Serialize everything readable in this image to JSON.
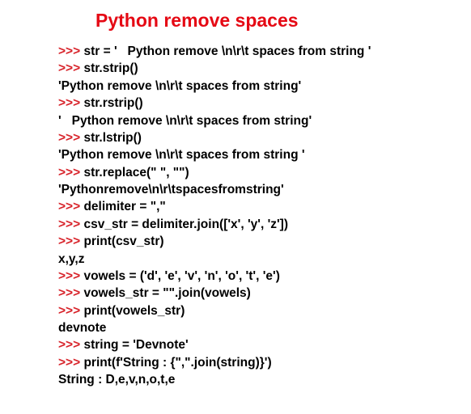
{
  "title": "Python remove spaces",
  "lines": [
    {
      "type": "input",
      "text": "str = '   Python remove \\n\\r\\t spaces from string '"
    },
    {
      "type": "input",
      "text": "str.strip()"
    },
    {
      "type": "output",
      "text": "'Python remove \\n\\r\\t spaces from string'"
    },
    {
      "type": "input",
      "text": "str.rstrip()"
    },
    {
      "type": "output",
      "text": "'   Python remove \\n\\r\\t spaces from string'"
    },
    {
      "type": "input",
      "text": "str.lstrip()"
    },
    {
      "type": "output",
      "text": "'Python remove \\n\\r\\t spaces from string '"
    },
    {
      "type": "input",
      "text": "str.replace(\" \", \"\")"
    },
    {
      "type": "output",
      "text": "'Pythonremove\\n\\r\\tspacesfromstring'"
    },
    {
      "type": "input",
      "text": "delimiter = \",\""
    },
    {
      "type": "input",
      "text": "csv_str = delimiter.join(['x', 'y', 'z'])"
    },
    {
      "type": "input",
      "text": "print(csv_str)"
    },
    {
      "type": "output",
      "text": "x,y,z"
    },
    {
      "type": "input",
      "text": "vowels = ('d', 'e', 'v', 'n', 'o', 't', 'e')"
    },
    {
      "type": "input",
      "text": "vowels_str = \"\".join(vowels)"
    },
    {
      "type": "input",
      "text": "print(vowels_str)"
    },
    {
      "type": "output",
      "text": "devnote"
    },
    {
      "type": "input",
      "text": "string = 'Devnote'"
    },
    {
      "type": "input",
      "text": "print(f'String : {\",\".join(string)}')"
    },
    {
      "type": "output",
      "text": "String : D,e,v,n,o,t,e"
    }
  ],
  "prompt": ">>> "
}
